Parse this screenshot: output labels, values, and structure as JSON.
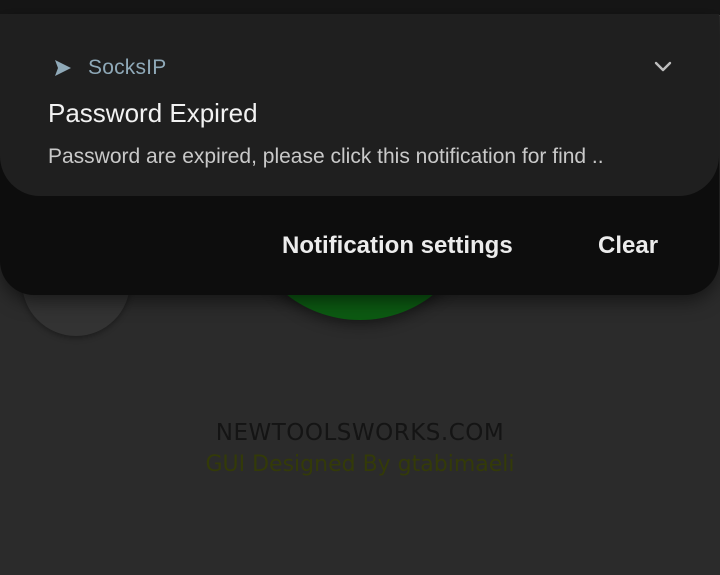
{
  "notification": {
    "app_name": "SocksIP",
    "app_icon": "play-arrow-icon",
    "title": "Password Expired",
    "body": "Password are expired, please click this notification for find ..",
    "expand_icon": "chevron-down-icon"
  },
  "actions": {
    "settings_label": "Notification settings",
    "clear_label": "Clear"
  },
  "background_app": {
    "site": "NEWTOOLSWORKS.COM",
    "credit": "GUI  Designed By gtabimaeli"
  },
  "colors": {
    "shade": "#0d0d0d",
    "card": "#1f1f1f",
    "app_name": "#8fa9b8",
    "connect_button": "#0c5a12",
    "credit_text": "#333a08"
  }
}
